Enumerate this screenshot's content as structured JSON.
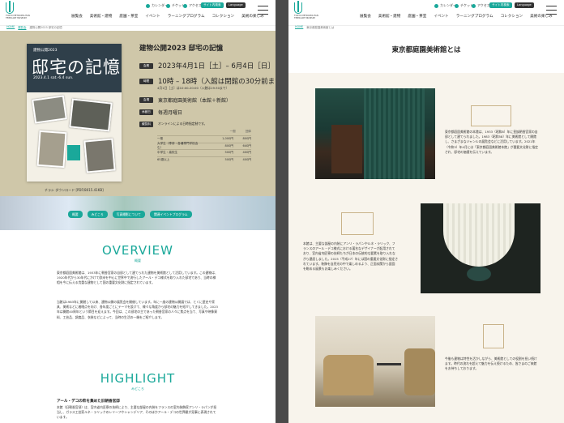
{
  "header": {
    "logo_text": "TOKYO METROPOLITAN TEIEN ART MUSEUM",
    "util": [
      "カレンダー",
      "チケット",
      "アクセス"
    ],
    "site_btn": "サイト内検索",
    "lang_btn": "Language",
    "nav": [
      "展覧会",
      "美術館・建物",
      "庭園・茶室",
      "イベント",
      "ラーニングプログラム",
      "コレクション",
      "美術の楽しみ"
    ]
  },
  "left": {
    "breadcrumb": [
      "HOME",
      "展覧会",
      "建物公開2023 邸宅の記憶"
    ],
    "poster": {
      "title": "邸宅の記憶",
      "year_text": "建物公開2023",
      "date_text": "2023.4.1 sat.-6.4 sun."
    },
    "download": "チラシ ダウンロード [PDF/8015.41KB]",
    "exhibition": {
      "title": "建物公開2023 邸宅の記憶",
      "labels": {
        "period": "会期",
        "hours": "時間",
        "venue": "会場",
        "closed": "休館日",
        "fee": "観覧料"
      },
      "period": "2023年4月1日［土］– 6月4日［日］",
      "hours": "10時 – 18時（入館は閉館の30分前まで）",
      "hours_sub": "4月1日［土］は10:00-20:00（入館は19:30まで）",
      "venue": "東京都庭園美術館（本館＋新館）",
      "closed": "毎週月曜日",
      "fee_note": "オンラインによる日時指定制です。",
      "price_head": [
        "一般",
        "団体"
      ],
      "prices": [
        {
          "cat": "一般",
          "gen": "1,000円",
          "grp": "800円"
        },
        {
          "cat": "大学生（専修・各種専門学校含む）",
          "gen": "800円",
          "grp": "640円"
        },
        {
          "cat": "中学生・高校生",
          "gen": "500円",
          "grp": "400円"
        },
        {
          "cat": "65歳以上",
          "gen": "500円",
          "grp": "400円"
        }
      ]
    },
    "tags": [
      "概要",
      "みどころ",
      "写真撮影について",
      "関連イベントプログラム"
    ],
    "overview": {
      "heading": "OVERVIEW",
      "sub": "概要",
      "p1": "東京都庭園美術館は、1933年に朝香宮家の自邸として建てられた建物を美術館として活用しています。この建物は、1920年代から30年代にかけて欧米を中心に世界中で流行したアール・デコ様式を取り入れた邸宅であり、当時の様相を今に伝える貴重な建物として国の重要文化財に指定されています。",
      "p2": "当館は1983年に開館して以来、建物公開の展覧会を開催しています。年に一度の建物公開展では、とくに歴史や家具、美術などに着眼点を向け、各年度ごとにテーマを設けて、様々な角度から邸宅の魅力を紹介してきました。2023年は開館40周年という節目を迎えます。今回は、この邸宅の主であった朝香宮家の人々に焦点を当て、写真や映像資料、工芸品、調度品、衣装などによって、当時の生活の一端をご紹介します。"
    },
    "highlight": {
      "heading": "HIGHLIGHT",
      "sub": "みどころ",
      "item_title": "アール・デコの粋を集めた旧朝香宮邸",
      "item_text": "本館（旧朝香宮邸）は、宮内省内匠寮の技師により、主要な部屋の内装をフランスの室内装飾家アンリ・ラパンが担当し、ガラス工芸家ルネ・ラリックのレリーフやシャンデリア、そのほかアール・デコの世界観が見事に表現されています。"
    }
  },
  "right": {
    "breadcrumb": [
      "HOME",
      "東京都庭園美術館とは"
    ],
    "title": "東京都庭園美術館とは",
    "p1": "東京都庭園美術館の本館は、1933（昭和8）年に皇族朝香宮家の自邸として建てられました。1983（昭和58）年に美術館として開館し、さまざまなジャンルの展覧会などに活用しています。2021年（令和3）年4月には「東京都庭園美術館本館」が重要文化財に指定され、邸宅の価値を伝えています。",
    "p2": "本館は、主要な部屋の内装にアンリ・ラパンやルネ・ラリック、フランスのアール・デコ様式における著名なデザイナーが起用されており、宮内省内匠寮の技師たちが日本の伝統的な要素を取り入れながら建設しました。2015（平成27）年には国の重要文化財に指定されています。装飾を自然光の中で楽しめるよう、正面玄関から庭園を眺める風景もお楽しみください。",
    "p3": "今後も建物は特性を活かしながら、美術館としての役割を担い続けます。時代の流れを超えて魅力を伝え続けるため、皆さまのご来館をお待ちしております。"
  }
}
